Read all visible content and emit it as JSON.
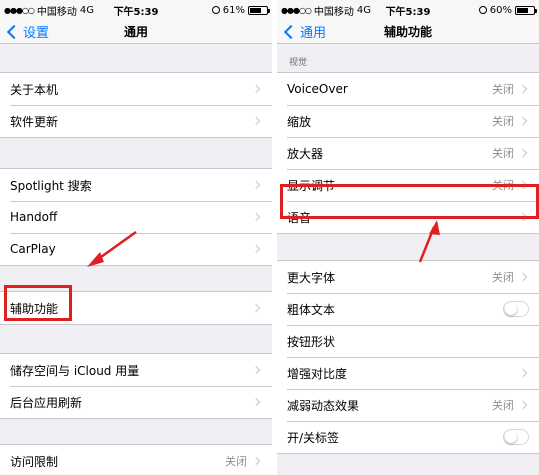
{
  "colors": {
    "accent": "#007aff",
    "highlight": "#e02020",
    "secondary_text": "#8e8e93"
  },
  "left": {
    "status": {
      "carrier": "中国移动",
      "network": "4G",
      "time": "下午5:39",
      "battery": "61%",
      "battery_level": 0.61
    },
    "nav": {
      "back": "设置",
      "title": "通用"
    },
    "groups": [
      [
        {
          "label": "关于本机"
        },
        {
          "label": "软件更新"
        }
      ],
      [
        {
          "label": "Spotlight 搜索"
        },
        {
          "label": "Handoff"
        },
        {
          "label": "CarPlay"
        }
      ],
      [
        {
          "label": "辅助功能"
        }
      ],
      [
        {
          "label": "储存空间与 iCloud 用量"
        },
        {
          "label": "后台应用刷新"
        }
      ],
      [
        {
          "label": "访问限制",
          "value": "关闭"
        }
      ]
    ]
  },
  "right": {
    "status": {
      "carrier": "中国移动",
      "network": "4G",
      "time": "下午5:39",
      "battery": "60%",
      "battery_level": 0.6
    },
    "nav": {
      "back": "通用",
      "title": "辅助功能"
    },
    "section_vision": "视觉",
    "groups": [
      [
        {
          "label": "VoiceOver",
          "value": "关闭"
        },
        {
          "label": "缩放",
          "value": "关闭"
        },
        {
          "label": "放大器",
          "value": "关闭"
        },
        {
          "label": "显示调节",
          "value": "关闭"
        },
        {
          "label": "语音"
        }
      ],
      [
        {
          "label": "更大字体",
          "value": "关闭"
        },
        {
          "label": "粗体文本",
          "toggle": false
        },
        {
          "label": "按钮形状"
        },
        {
          "label": "增强对比度"
        },
        {
          "label": "减弱动态效果",
          "value": "关闭"
        },
        {
          "label": "开/关标签",
          "toggle": false
        }
      ]
    ]
  }
}
